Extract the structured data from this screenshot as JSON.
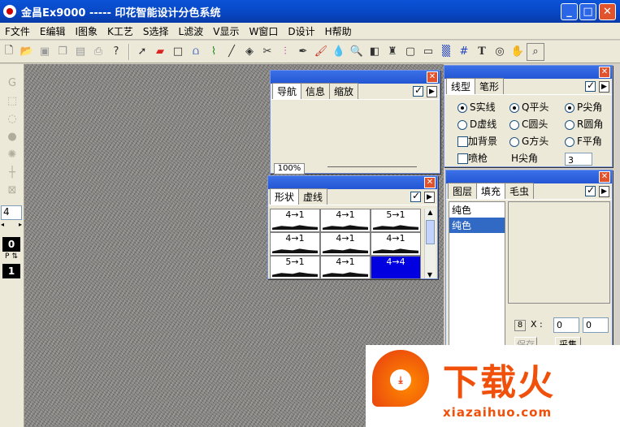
{
  "window": {
    "title": "金昌Ex9000 ----- 印花智能设计分色系统",
    "min": "_",
    "max": "□",
    "close": "✕"
  },
  "menu": [
    "F文件",
    "E编辑",
    "I图象",
    "K工艺",
    "S选择",
    "L滤波",
    "V显示",
    "W窗口",
    "D设计",
    "H帮助"
  ],
  "toolbar_icons": [
    "new-file-icon",
    "open-folder-icon",
    "save-icon",
    "copy-icon",
    "paste-icon",
    "print-icon",
    "help-icon",
    "arrow-select-icon",
    "eraser-icon",
    "rectangle-icon",
    "bridge-icon",
    "brush-curve-icon",
    "line-icon",
    "fill-bucket-icon",
    "scissors-icon",
    "mirror-icon",
    "pen-icon",
    "paint-brush-icon",
    "drop-icon",
    "zoom-icon",
    "gradient-icon",
    "stamp-icon",
    "frame-icon",
    "window-icon",
    "texture-icon",
    "grid-icon",
    "text-icon",
    "spiral-icon",
    "hand-icon",
    "magnify-icon"
  ],
  "left_tools": {
    "size_value": "4",
    "layer_top": "0",
    "pd_label": "P",
    "layer_bottom": "1"
  },
  "nav_panel": {
    "tabs": [
      "导航",
      "信息",
      "缩放"
    ],
    "zoom": "100%"
  },
  "shape_panel": {
    "tabs": [
      "形状",
      "虚线"
    ],
    "cells": [
      {
        "label": "4→1",
        "selected": false
      },
      {
        "label": "4→1",
        "selected": false
      },
      {
        "label": "5→1",
        "selected": false
      },
      {
        "label": "4→1",
        "selected": false
      },
      {
        "label": "4→1",
        "selected": false
      },
      {
        "label": "4→1",
        "selected": false
      },
      {
        "label": "5→1",
        "selected": false
      },
      {
        "label": "4→1",
        "selected": false
      },
      {
        "label": "4→4",
        "selected": true
      }
    ]
  },
  "line_panel": {
    "tabs": [
      "线型",
      "笔形"
    ],
    "col1": [
      {
        "label": "S实线",
        "type": "radio",
        "on": true
      },
      {
        "label": "D虚线",
        "type": "radio",
        "on": false
      },
      {
        "label": "加背景",
        "type": "check",
        "on": false
      },
      {
        "label": "喷枪",
        "type": "check",
        "on": false
      }
    ],
    "col2": [
      {
        "label": "Q平头",
        "type": "radio",
        "on": true
      },
      {
        "label": "C圆头",
        "type": "radio",
        "on": false
      },
      {
        "label": "G方头",
        "type": "radio",
        "on": false
      },
      {
        "label": "H尖角",
        "type": "text"
      }
    ],
    "col3": [
      {
        "label": "P尖角",
        "type": "radio",
        "on": true
      },
      {
        "label": "R圆角",
        "type": "radio",
        "on": false
      },
      {
        "label": "F平角",
        "type": "radio",
        "on": false
      }
    ],
    "angle_value": "3"
  },
  "layer_panel": {
    "tabs": [
      "图层",
      "填充",
      "毛虫"
    ],
    "list_top": "纯色",
    "list_selected": "纯色",
    "eight": "8",
    "x_label": "X :",
    "x_value": "0",
    "y_value": "0",
    "btn1": "保存",
    "btn2": "采集"
  },
  "watermark": {
    "brand": "下载火",
    "url": "xiazaihuo.com"
  }
}
